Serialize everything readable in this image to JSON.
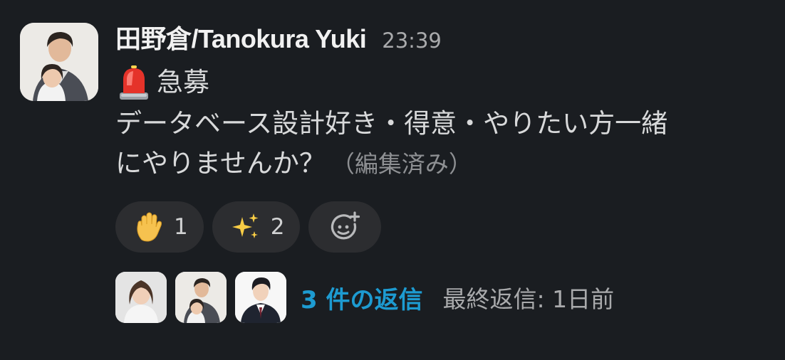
{
  "message": {
    "author": "田野倉/Tanokura Yuki",
    "timestamp": "23:39",
    "line1_text": "急募",
    "line2_text": "データベース設計好き・得意・やりたい方一緒",
    "line3_text": "にやりませんか？",
    "edited_label": "（編集済み）",
    "siren_icon": "rotating-light-icon"
  },
  "reactions": [
    {
      "icon": "raised-hand-icon",
      "count": "1"
    },
    {
      "icon": "sparkles-icon",
      "count": "2"
    }
  ],
  "add_reaction_icon": "add-reaction-icon",
  "thread": {
    "reply_count_label": "3 件の返信",
    "last_reply_label": "最終返信: 1日前"
  },
  "colors": {
    "background": "#1a1d21",
    "pill": "#2c2d30",
    "link": "#1d9bd1",
    "muted": "#a9aaac"
  }
}
